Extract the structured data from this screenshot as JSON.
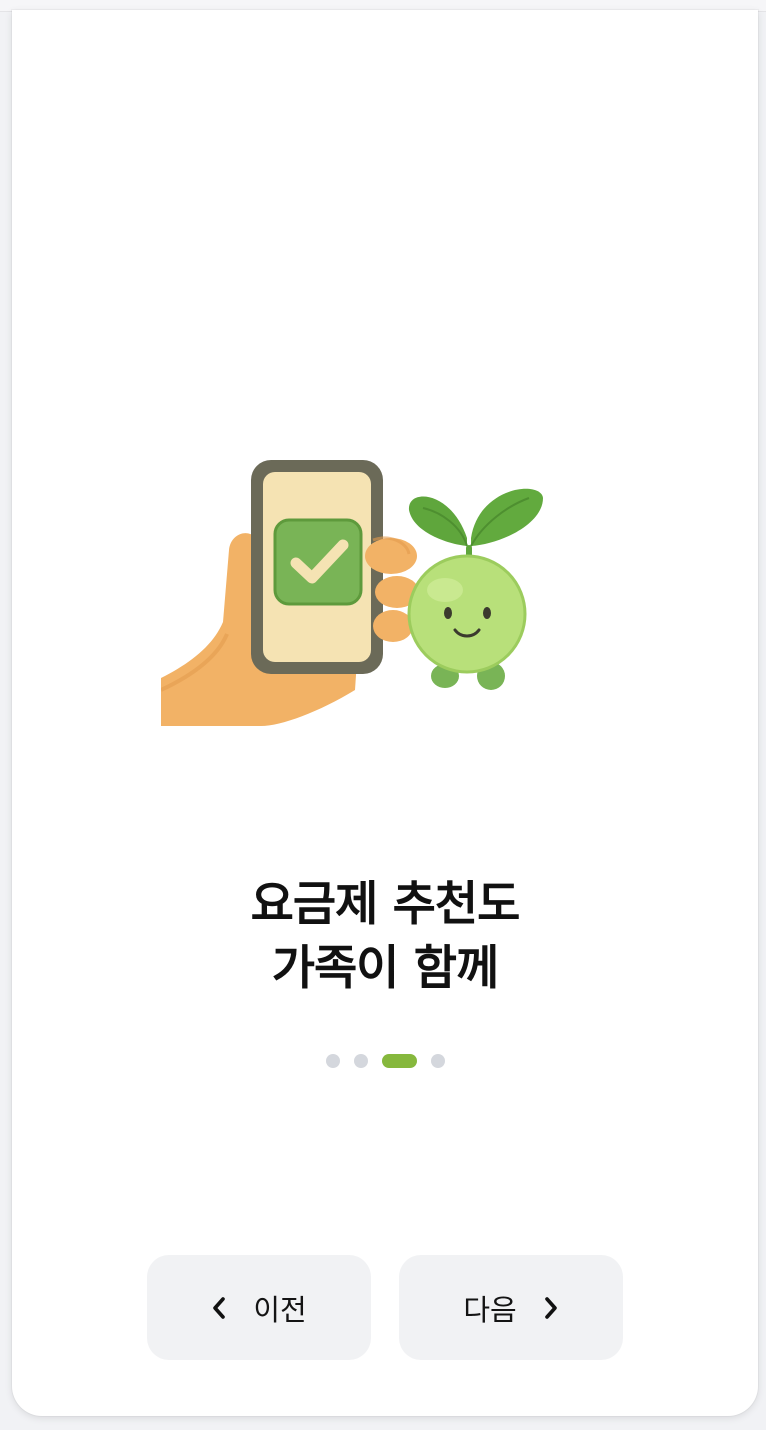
{
  "onboarding": {
    "headline_line1": "요금제 추천도",
    "headline_line2": "가족이 함께",
    "pagination": {
      "total": 4,
      "active_index": 2,
      "active_color": "#86b83d",
      "inactive_color": "#d4d7dd"
    },
    "illustration": {
      "icons": [
        "hand-holding-phone-icon",
        "checkmark-icon",
        "sprout-mascot-icon"
      ]
    },
    "prev_button": {
      "label": "이전",
      "icon": "chevron-left-icon"
    },
    "next_button": {
      "label": "다음",
      "icon": "chevron-right-icon"
    }
  }
}
